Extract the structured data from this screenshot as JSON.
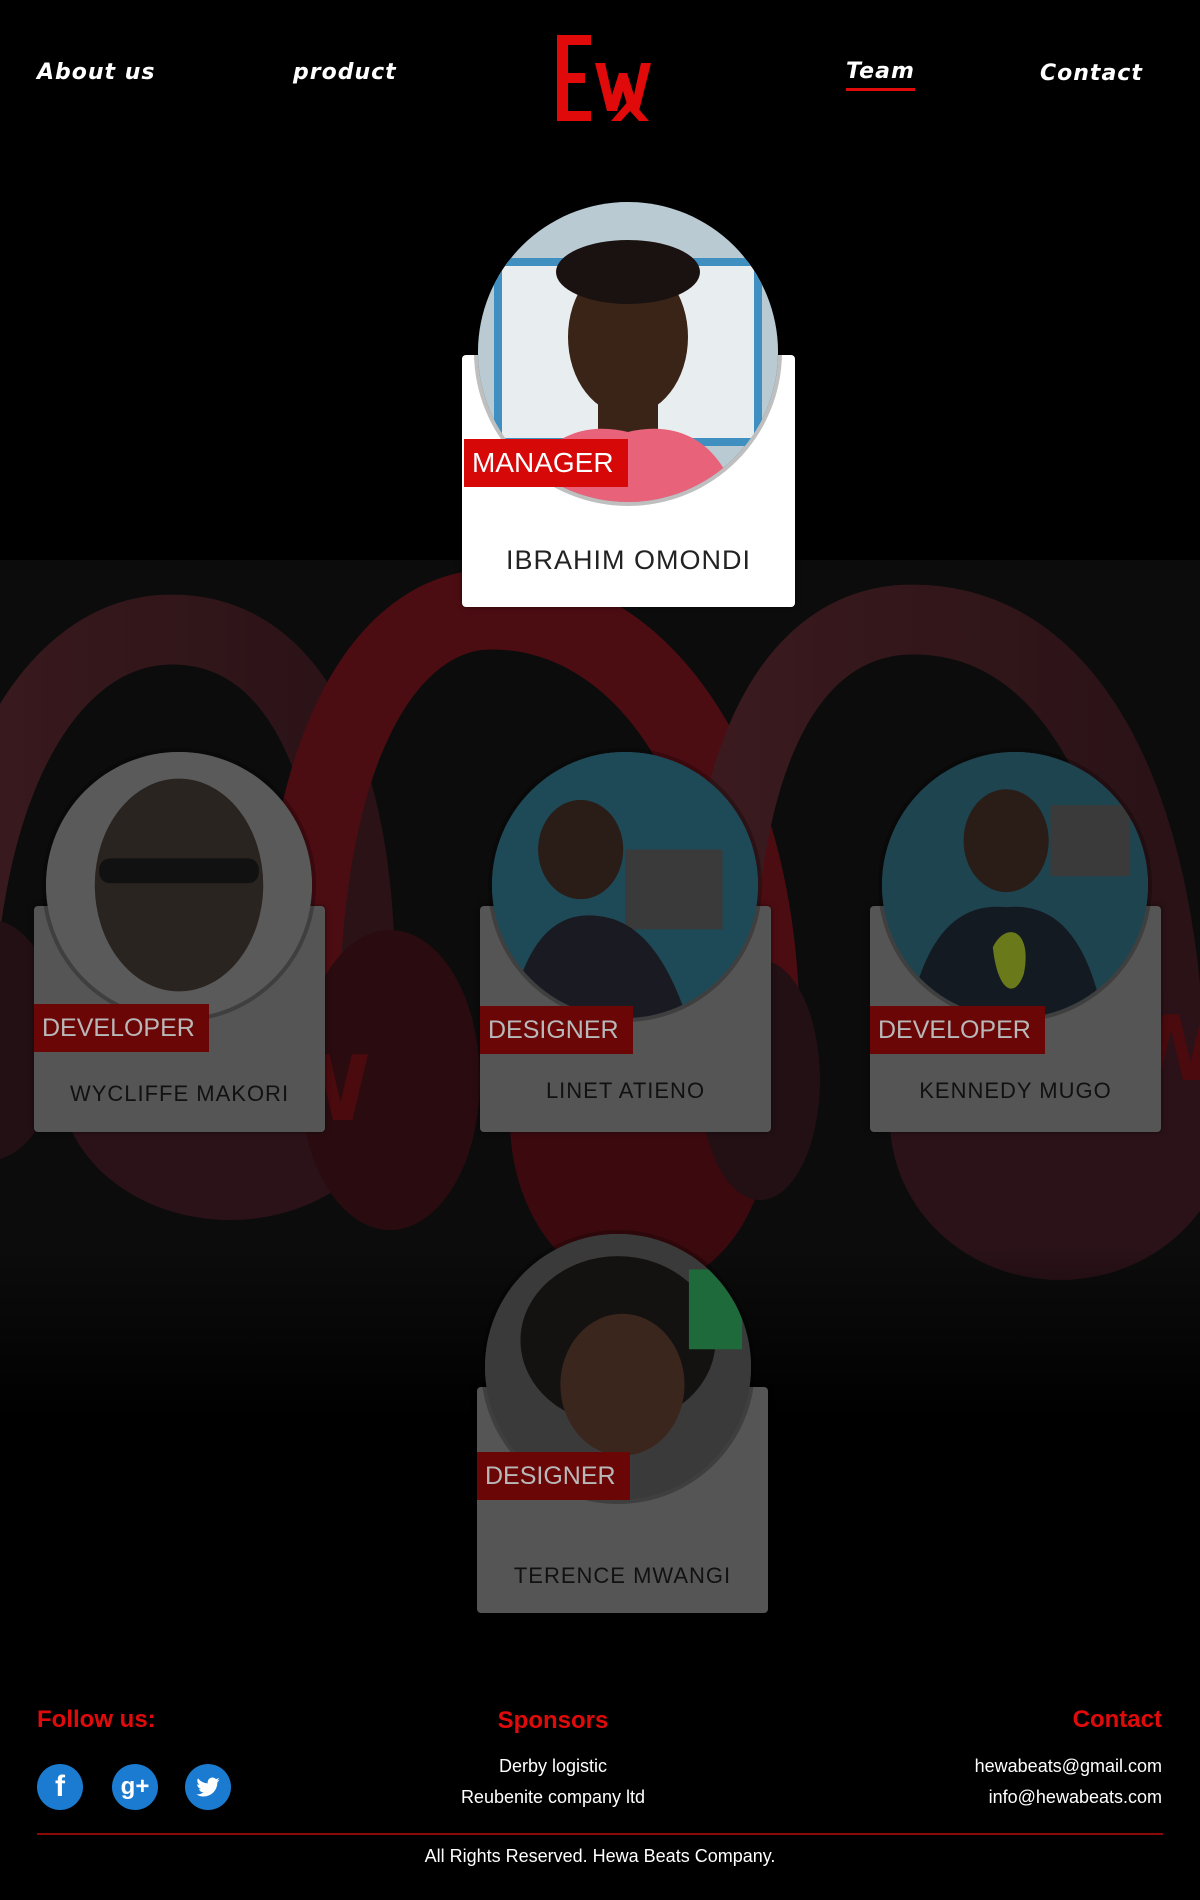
{
  "nav": {
    "about": "About us",
    "product": "product",
    "team": "Team",
    "contact": "Contact",
    "active": "Team"
  },
  "logo": {
    "alt": "EW"
  },
  "team": {
    "manager": {
      "role": "MANAGER",
      "name": "IBRAHIM  OMONDI"
    },
    "members": [
      {
        "role": "DEVELOPER",
        "name": "WYCLIFFE MAKORI"
      },
      {
        "role": "DESIGNER",
        "name": "LINET ATIENO"
      },
      {
        "role": "DEVELOPER",
        "name": "KENNEDY MUGO"
      },
      {
        "role": "DESIGNER",
        "name": "TERENCE MWANGI"
      }
    ]
  },
  "footer": {
    "follow_title": "Follow us:",
    "social": [
      {
        "icon": "facebook-icon",
        "glyph": "f"
      },
      {
        "icon": "google-plus-icon",
        "glyph": "g+"
      },
      {
        "icon": "twitter-icon",
        "glyph": "t"
      }
    ],
    "sponsors_title": "Sponsors",
    "sponsors": [
      "Derby logistic",
      "Reubenite company ltd"
    ],
    "contact_title": "Contact",
    "contacts": [
      "hewabeats@gmail.com",
      "info@hewabeats.com"
    ],
    "copyright": "All Rights Reserved. Hewa Beats Company."
  },
  "colors": {
    "accent": "#e00a0a",
    "background": "#000000",
    "social_blue": "#1a7bd0"
  }
}
